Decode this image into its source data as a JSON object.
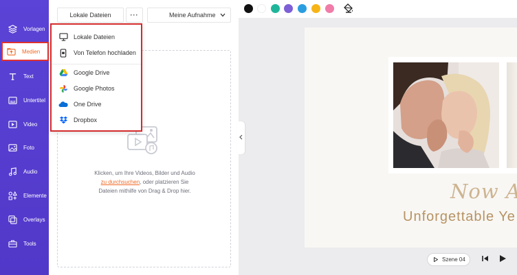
{
  "sidebar": {
    "items": [
      {
        "label": "Vorlagen",
        "icon": "layers-icon"
      },
      {
        "label": "Medien",
        "icon": "media-folder-icon",
        "active": true
      },
      {
        "label": "Text",
        "icon": "text-icon"
      },
      {
        "label": "Untertitel",
        "icon": "subtitle-icon"
      },
      {
        "label": "Video",
        "icon": "video-icon"
      },
      {
        "label": "Foto",
        "icon": "photo-icon"
      },
      {
        "label": "Audio",
        "icon": "music-icon"
      },
      {
        "label": "Elemente",
        "icon": "elements-icon"
      },
      {
        "label": "Overlays",
        "icon": "overlays-icon"
      },
      {
        "label": "Tools",
        "icon": "toolbox-icon"
      }
    ],
    "bg_color": "#5a43d6",
    "active_color": "#f06a26"
  },
  "panel": {
    "local_files_label": "Lokale Dateien",
    "more_label": "···",
    "recordings_label": "Meine Aufnahme",
    "drop_text_line1": "Klicken, um Ihre Videos, Bilder und Audio",
    "drop_link": "zu durchsuchen",
    "drop_text_line2_rest": ", oder platzieren Sie",
    "drop_text_line3": "Dateien mithilfe von Drag & Drop hier."
  },
  "dropdown": {
    "items": [
      {
        "label": "Lokale Dateien",
        "icon": "monitor-icon"
      },
      {
        "label": "Von Telefon hochladen",
        "icon": "phone-icon"
      },
      {
        "label": "Google Drive",
        "icon": "google-drive-icon"
      },
      {
        "label": "Google Photos",
        "icon": "google-photos-icon"
      },
      {
        "label": "One Drive",
        "icon": "onedrive-icon"
      },
      {
        "label": "Dropbox",
        "icon": "dropbox-icon"
      }
    ]
  },
  "toolbar": {
    "swatches": [
      "#111111",
      "#ffffff",
      "#1fb59a",
      "#7d5fd6",
      "#2a9de0",
      "#f7b417",
      "#f07ca8"
    ],
    "fill_icon": "paint-bucket-icon"
  },
  "canvas": {
    "script_text": "Now Af",
    "title_text": "Unforgettable Ye"
  },
  "playback": {
    "scene_label": "Szene 04"
  }
}
